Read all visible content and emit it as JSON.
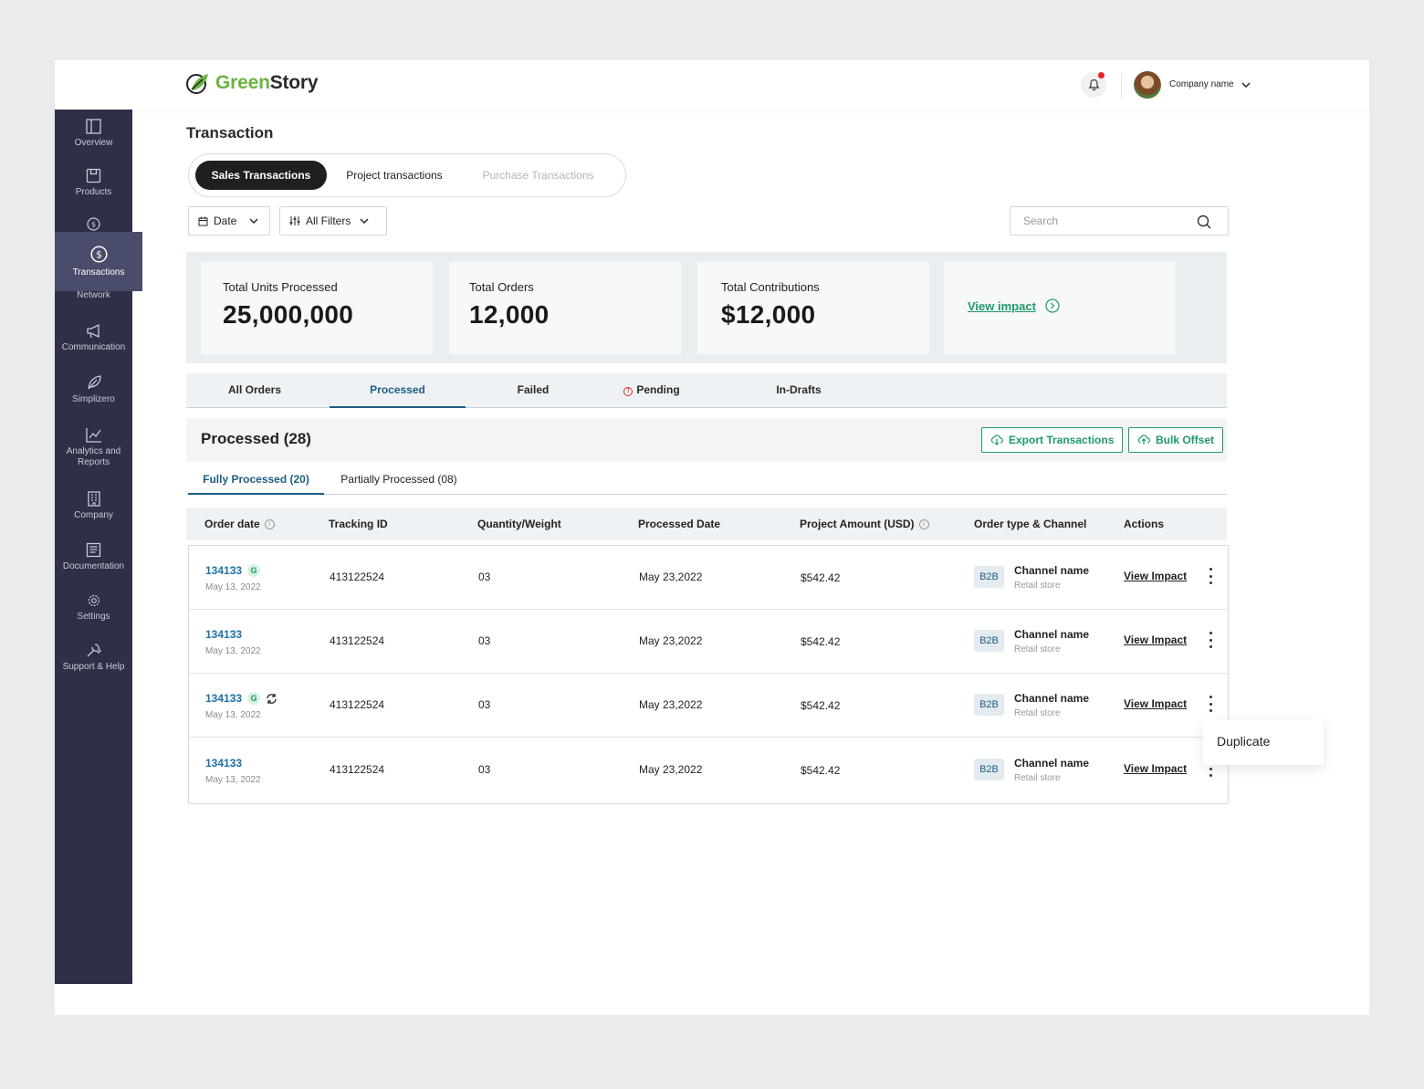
{
  "brand": {
    "name_green": "Green",
    "name_dark": "Story",
    "accent": "#6cb33f"
  },
  "header": {
    "company_label": "Company name",
    "has_notification": true
  },
  "sidebar": {
    "items": [
      {
        "label": "Overview",
        "icon": "panel-icon"
      },
      {
        "label": "Products",
        "icon": "box-icon"
      },
      {
        "label": "Transactions",
        "icon": "dollar-circle-icon",
        "active": true
      },
      {
        "label": "Network",
        "icon": "network-icon"
      },
      {
        "label": "Communication",
        "icon": "megaphone-icon"
      },
      {
        "label": "Simplizero",
        "icon": "leaf-icon"
      },
      {
        "label": "Analytics and Reports",
        "icon": "line-chart-icon"
      },
      {
        "label": "Company",
        "icon": "building-icon"
      },
      {
        "label": "Documentation",
        "icon": "document-icon"
      },
      {
        "label": "Settings",
        "icon": "gear-icon"
      },
      {
        "label": "Support & Help",
        "icon": "tools-icon"
      }
    ]
  },
  "page": {
    "title": "Transaction"
  },
  "segments": {
    "sales": "Sales Transactions",
    "project": "Project transactions",
    "purchase": "Purchase Transactions"
  },
  "filters": {
    "date": "Date",
    "all": "All Filters"
  },
  "search": {
    "placeholder": "Search"
  },
  "stats": {
    "units_label": "Total Units Processed",
    "units_value": "25,000,000",
    "orders_label": "Total Orders",
    "orders_value": "12,000",
    "contrib_label": "Total Contributions",
    "contrib_value": "$12,000",
    "view_impact": "View impact"
  },
  "tabs": {
    "all": "All Orders",
    "processed": "Processed",
    "failed": "Failed",
    "pending": "Pending",
    "drafts": "In-Drafts"
  },
  "section": {
    "title": "Processed (28)",
    "export": "Export Transactions",
    "bulk": "Bulk Offset"
  },
  "subtabs": {
    "fully": "Fully Processed (20)",
    "partial": "Partially Processed (08)"
  },
  "table": {
    "headers": {
      "order_date": "Order date",
      "tracking": "Tracking ID",
      "quantity": "Quantity/Weight",
      "processed": "Processed Date",
      "amount": "Project Amount (USD)",
      "channel": "Order type & Channel",
      "actions": "Actions"
    },
    "rows": [
      {
        "order_id": "134133",
        "order_date": "May 13, 2022",
        "tracking": "413122524",
        "quantity": "03",
        "processed": "May 23,2022",
        "amount": "$542.42",
        "type": "B2B",
        "channel": "Channel name",
        "channel_sub": "Retail store",
        "action": "View Impact",
        "g_badge": "G"
      },
      {
        "order_id": "134133",
        "order_date": "May 13, 2022",
        "tracking": "413122524",
        "quantity": "03",
        "processed": "May 23,2022",
        "amount": "$542.42",
        "type": "B2B",
        "channel": "Channel name",
        "channel_sub": "Retail store",
        "action": "View Impact"
      },
      {
        "order_id": "134133",
        "order_date": "May 13, 2022",
        "tracking": "413122524",
        "quantity": "03",
        "processed": "May 23,2022",
        "amount": "$542.42",
        "type": "B2B",
        "channel": "Channel name",
        "channel_sub": "Retail store",
        "action": "View Impact",
        "g_badge": "G"
      },
      {
        "order_id": "134133",
        "order_date": "May 13, 2022",
        "tracking": "413122524",
        "quantity": "03",
        "processed": "May 23,2022",
        "amount": "$542.42",
        "type": "B2B",
        "channel": "Channel name",
        "channel_sub": "Retail store",
        "action": "View Impact"
      }
    ]
  },
  "menu": {
    "duplicate": "Duplicate"
  }
}
